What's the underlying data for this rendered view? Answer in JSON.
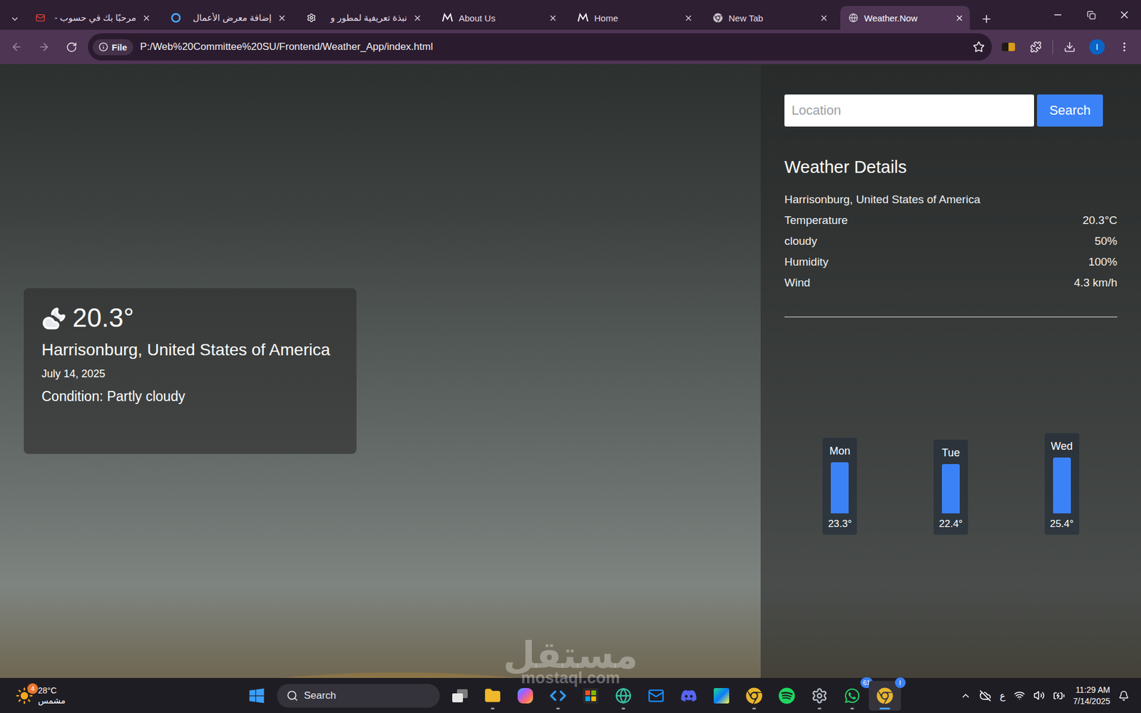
{
  "browser": {
    "tabs": [
      {
        "label": "مرحبًا بك في حسوب -",
        "icon": "gmail",
        "selected": false
      },
      {
        "label": "إضافة معرض الأعمال",
        "icon": "ring",
        "selected": false
      },
      {
        "label": "نبذة تعريفية لمطور و",
        "icon": "openai",
        "selected": false
      },
      {
        "label": "About Us",
        "icon": "mostaql",
        "selected": false
      },
      {
        "label": "Home",
        "icon": "mostaql",
        "selected": false
      },
      {
        "label": "New Tab",
        "icon": "chrome",
        "selected": false
      },
      {
        "label": "Weather.Now",
        "icon": "globe",
        "selected": true
      }
    ],
    "address": {
      "chip": "File",
      "url": "P:/Web%20Committee%20SU/Frontend/Weather_App/index.html"
    },
    "profile": "I"
  },
  "app": {
    "search": {
      "placeholder": "Location",
      "button": "Search"
    },
    "current": {
      "temperature": "20.3°",
      "location": "Harrisonburg, United States of America",
      "date": "July 14, 2025",
      "condition": "Condition: Partly cloudy"
    },
    "details": {
      "title": "Weather Details",
      "location": "Harrisonburg, United States of America",
      "rows": [
        {
          "label": "Temperature",
          "value": "20.3°C"
        },
        {
          "label": "cloudy",
          "value": "50%"
        },
        {
          "label": "Humidity",
          "value": "100%"
        },
        {
          "label": "Wind",
          "value": "4.3 km/h"
        }
      ]
    },
    "forecast": {
      "days": [
        {
          "label": "Mon",
          "reading": "23.3°"
        },
        {
          "label": "Tue",
          "reading": "22.4°"
        },
        {
          "label": "Wed",
          "reading": "25.4°"
        }
      ],
      "values": [
        23.3,
        22.4,
        25.4
      ]
    }
  },
  "taskbar": {
    "weather": {
      "temperature": "28°C",
      "condition": "مشمس",
      "badge": "4"
    },
    "search": "Search",
    "apps": [
      {
        "kind": "taskview",
        "running": false,
        "active": false,
        "badge": ""
      },
      {
        "kind": "explorer",
        "running": true,
        "active": false,
        "badge": ""
      },
      {
        "kind": "copilot",
        "running": false,
        "active": false,
        "badge": ""
      },
      {
        "kind": "vscode",
        "running": true,
        "active": false,
        "badge": ""
      },
      {
        "kind": "store",
        "running": false,
        "active": false,
        "badge": ""
      },
      {
        "kind": "teams",
        "running": true,
        "active": false,
        "badge": ""
      },
      {
        "kind": "outlook",
        "running": false,
        "active": false,
        "badge": ""
      },
      {
        "kind": "discord",
        "running": false,
        "active": false,
        "badge": ""
      },
      {
        "kind": "clion",
        "running": false,
        "active": false,
        "badge": ""
      },
      {
        "kind": "chrome",
        "running": true,
        "active": false,
        "badge": ""
      },
      {
        "kind": "spotify",
        "running": false,
        "active": false,
        "badge": ""
      },
      {
        "kind": "settings",
        "running": true,
        "active": false,
        "badge": ""
      },
      {
        "kind": "whatsapp",
        "running": true,
        "active": false,
        "badge": "61"
      },
      {
        "kind": "chrome",
        "running": true,
        "active": true,
        "badge": "I"
      }
    ],
    "tray": {
      "keyboard": "ع",
      "time": "11:29 AM",
      "date": "7/14/2025"
    }
  },
  "watermark": {
    "arabic": "مستقل",
    "latin": "mostaql.com"
  }
}
